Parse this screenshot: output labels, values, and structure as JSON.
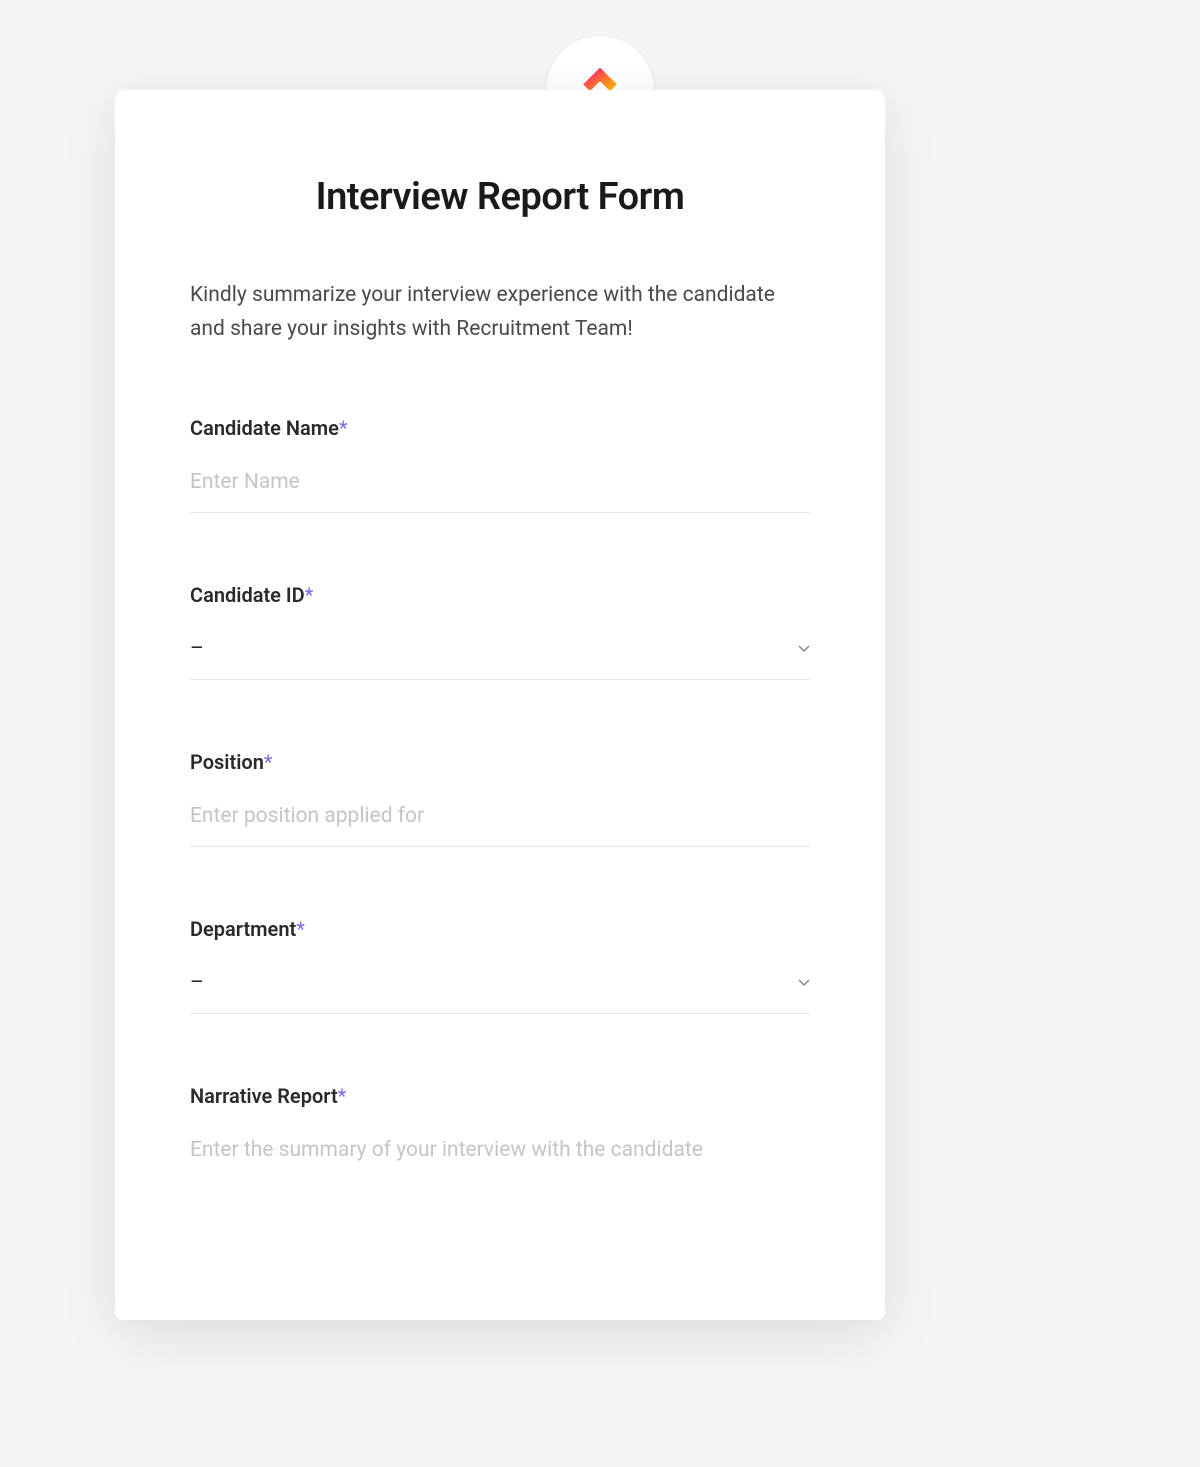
{
  "form": {
    "title": "Interview Report Form",
    "description": "Kindly summarize your interview experience with the candidate and share your insights with Recruitment Team!",
    "fields": {
      "candidate_name": {
        "label": "Candidate Name",
        "required_marker": "*",
        "placeholder": "Enter Name"
      },
      "candidate_id": {
        "label": "Candidate ID",
        "required_marker": "*",
        "selected_value": "–"
      },
      "position": {
        "label": "Position",
        "required_marker": "*",
        "placeholder": "Enter position applied for"
      },
      "department": {
        "label": "Department",
        "required_marker": "*",
        "selected_value": "–"
      },
      "narrative_report": {
        "label": "Narrative Report",
        "required_marker": "*",
        "placeholder": "Enter the summary of your interview with the candidate"
      }
    }
  },
  "icons": {
    "logo": "clickup-logo",
    "dropdown": "chevron-down"
  }
}
